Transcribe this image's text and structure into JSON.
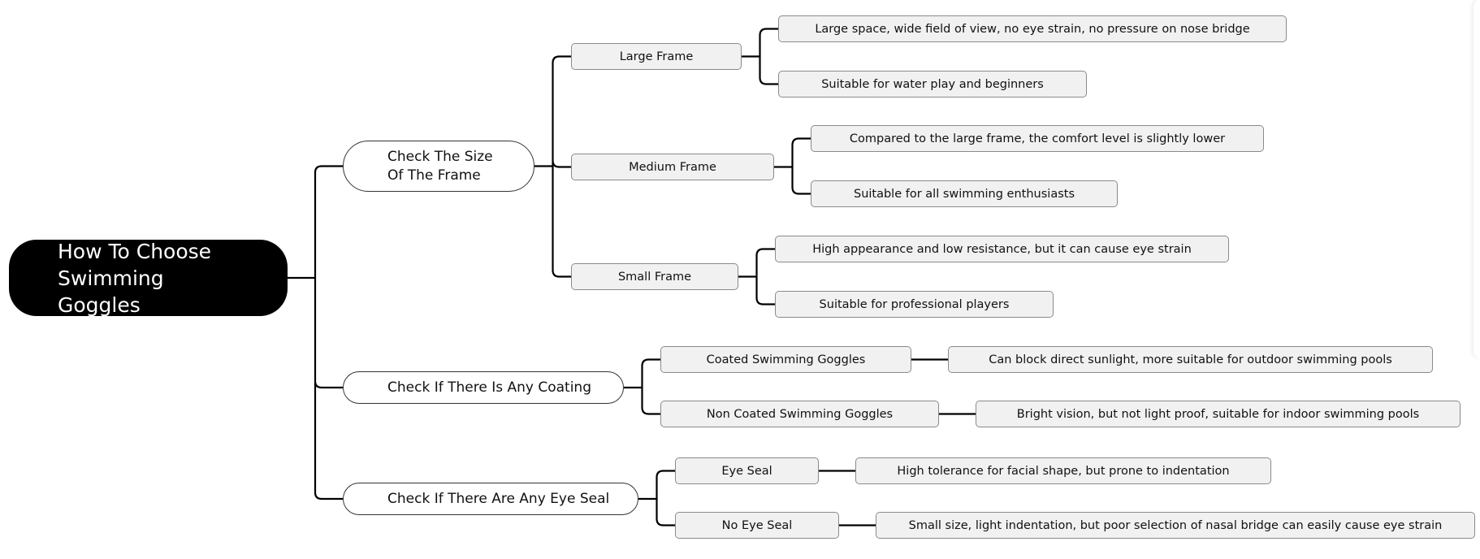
{
  "root": {
    "label": "How To Choose Swimming Goggles"
  },
  "branches": [
    {
      "label": "Check The Size Of The Frame",
      "children": [
        {
          "label": "Large Frame",
          "details": [
            "Large space, wide field of view, no eye strain, no pressure on nose bridge",
            "Suitable for water play and beginners"
          ]
        },
        {
          "label": "Medium Frame",
          "details": [
            "Compared to the large frame, the comfort level is slightly lower",
            "Suitable for all swimming enthusiasts"
          ]
        },
        {
          "label": "Small Frame",
          "details": [
            "High appearance and low resistance, but it can cause eye strain",
            "Suitable for professional players"
          ]
        }
      ]
    },
    {
      "label": "Check If There Is Any Coating",
      "children": [
        {
          "label": "Coated Swimming Goggles",
          "details": [
            "Can block direct sunlight, more suitable for outdoor swimming pools"
          ]
        },
        {
          "label": "Non Coated Swimming Goggles",
          "details": [
            "Bright vision, but not light proof, suitable for indoor swimming pools"
          ]
        }
      ]
    },
    {
      "label": "Check If There Are Any Eye Seal",
      "children": [
        {
          "label": "Eye Seal",
          "details": [
            "High tolerance for facial shape, but prone to indentation"
          ]
        },
        {
          "label": "No Eye Seal",
          "details": [
            "Small size, light indentation, but poor selection of nasal bridge can easily cause eye strain"
          ]
        }
      ]
    }
  ],
  "colors": {
    "line": "#000000",
    "root_fill": "#000000",
    "leaf_fill": "#f1f1f1"
  }
}
